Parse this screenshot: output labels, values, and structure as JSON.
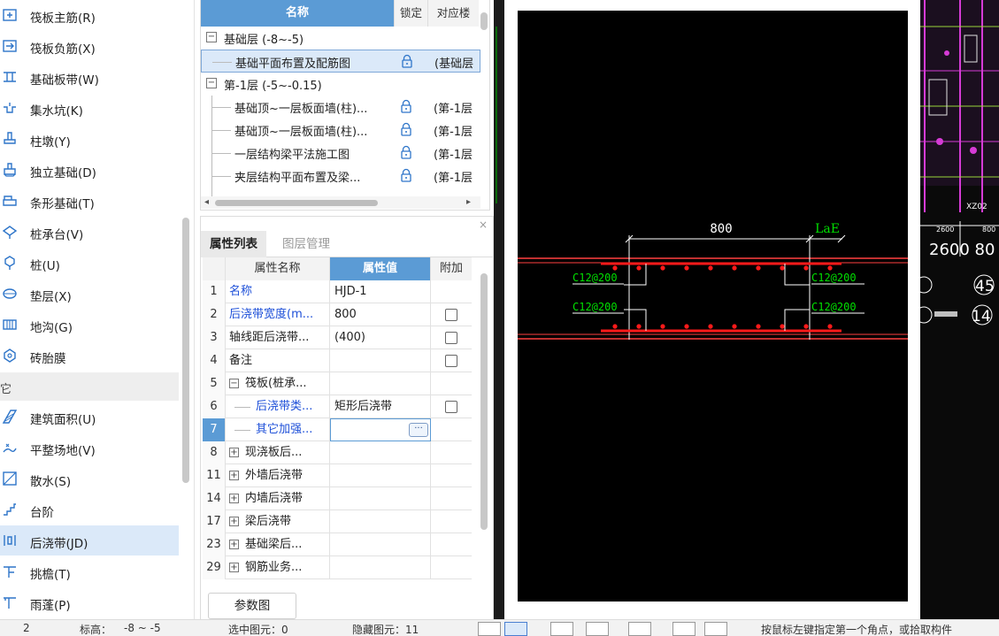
{
  "sidebar": {
    "items": [
      {
        "label": "筏板主筋(R)",
        "icon": "raft-main-rebar-icon"
      },
      {
        "label": "筏板负筋(X)",
        "icon": "raft-negative-rebar-icon"
      },
      {
        "label": "基础板带(W)",
        "icon": "foundation-strip-icon"
      },
      {
        "label": "集水坑(K)",
        "icon": "sump-pit-icon"
      },
      {
        "label": "柱墩(Y)",
        "icon": "column-pier-icon"
      },
      {
        "label": "独立基础(D)",
        "icon": "isolated-footing-icon"
      },
      {
        "label": "条形基础(T)",
        "icon": "strip-footing-icon"
      },
      {
        "label": "桩承台(V)",
        "icon": "pile-cap-icon"
      },
      {
        "label": "桩(U)",
        "icon": "pile-icon"
      },
      {
        "label": "垫层(X)",
        "icon": "cushion-layer-icon"
      },
      {
        "label": "地沟(G)",
        "icon": "trench-icon"
      },
      {
        "label": "砖胎膜",
        "icon": "brick-mold-icon"
      }
    ],
    "group_label": "它",
    "items2": [
      {
        "label": "建筑面积(U)",
        "icon": "building-area-icon"
      },
      {
        "label": "平整场地(V)",
        "icon": "site-leveling-icon"
      },
      {
        "label": "散水(S)",
        "icon": "apron-icon"
      },
      {
        "label": "台阶",
        "icon": "steps-icon"
      },
      {
        "label": "后浇带(JD)",
        "icon": "post-cast-strip-icon",
        "selected": true
      },
      {
        "label": "挑檐(T)",
        "icon": "eave-icon"
      },
      {
        "label": "雨蓬(P)",
        "icon": "canopy-icon"
      }
    ]
  },
  "drawing_panel": {
    "headers": {
      "name": "名称",
      "lock": "锁定",
      "floor": "对应楼"
    },
    "rows": [
      {
        "type": "group",
        "name": "基础层 (-8~-5)",
        "expand": "−"
      },
      {
        "type": "item",
        "name": "基础平面布置及配筋图",
        "floor": "(基础层",
        "selected": true
      },
      {
        "type": "group",
        "name": "第-1层 (-5~-0.15)",
        "expand": "−"
      },
      {
        "type": "item",
        "name": "基础顶~一层板面墙(柱)...",
        "floor": "(第-1层"
      },
      {
        "type": "item",
        "name": "基础顶~一层板面墙(柱)...",
        "floor": "(第-1层"
      },
      {
        "type": "item",
        "name": "一层结构梁平法施工图",
        "floor": "(第-1层"
      },
      {
        "type": "item",
        "name": "夹层结构平面布置及梁...",
        "floor": "(第-1层"
      }
    ]
  },
  "property_panel": {
    "tabs": [
      "属性列表",
      "图层管理"
    ],
    "close": "×",
    "headers": {
      "name": "属性名称",
      "value": "属性值",
      "extra": "附加"
    },
    "rows": [
      {
        "num": "1",
        "name": "名称",
        "value": "HJD-1",
        "blue": true,
        "checkbox": false
      },
      {
        "num": "2",
        "name": "后浇带宽度(m...",
        "value": "800",
        "blue": true,
        "checkbox": true
      },
      {
        "num": "3",
        "name": "轴线距后浇带...",
        "value": "(400)",
        "blue": false,
        "checkbox": true
      },
      {
        "num": "4",
        "name": "备注",
        "value": "",
        "blue": false,
        "checkbox": true
      },
      {
        "num": "5",
        "name": "筏板(桩承...",
        "value": "",
        "blue": false,
        "checkbox": false,
        "expand": "−",
        "indent": 0
      },
      {
        "num": "6",
        "name": "后浇带类...",
        "value": "矩形后浇带",
        "blue": true,
        "checkbox": true,
        "indent": 1
      },
      {
        "num": "7",
        "name": "其它加强...",
        "value": "",
        "blue": true,
        "checkbox": false,
        "indent": 1,
        "active": true,
        "button": "···"
      },
      {
        "num": "8",
        "name": "现浇板后...",
        "value": "",
        "blue": false,
        "checkbox": false,
        "expand": "+",
        "indent": 0
      },
      {
        "num": "11",
        "name": "外墙后浇带",
        "value": "",
        "blue": false,
        "checkbox": false,
        "expand": "+",
        "indent": 0
      },
      {
        "num": "14",
        "name": "内墙后浇带",
        "value": "",
        "blue": false,
        "checkbox": false,
        "expand": "+",
        "indent": 0
      },
      {
        "num": "17",
        "name": "梁后浇带",
        "value": "",
        "blue": false,
        "checkbox": false,
        "expand": "+",
        "indent": 0
      },
      {
        "num": "23",
        "name": "基础梁后...",
        "value": "",
        "blue": false,
        "checkbox": false,
        "expand": "+",
        "indent": 0
      },
      {
        "num": "29",
        "name": "钢筋业务...",
        "value": "",
        "blue": false,
        "checkbox": false,
        "expand": "+",
        "indent": 0
      }
    ],
    "param_button": "参数图"
  },
  "diagram": {
    "dim_width": "800",
    "dim_lae": "LaE",
    "rebar_labels": [
      "C12@200",
      "C12@200",
      "C12@200",
      "C12@200"
    ],
    "colors": {
      "background": "#000000",
      "rebar": "#ff1a1a",
      "text_green": "#00e000",
      "dim": "#ffffff",
      "slab_line": "#ff4040"
    }
  },
  "cad_background": {
    "labels": [
      "XZ02",
      "2600",
      "800",
      "2600 80",
      "45",
      "14"
    ]
  },
  "status_bar": {
    "items": [
      "2",
      "标高：",
      "-8 ~ -5",
      "选中图元：0",
      "隐藏图元：11"
    ],
    "hint": "按鼠标左键指定第一个角点，或拾取构件"
  },
  "colors": {
    "accent": "#5b9bd5",
    "selected_bg": "#dbe9f9",
    "link_blue": "#1d4fd8"
  }
}
